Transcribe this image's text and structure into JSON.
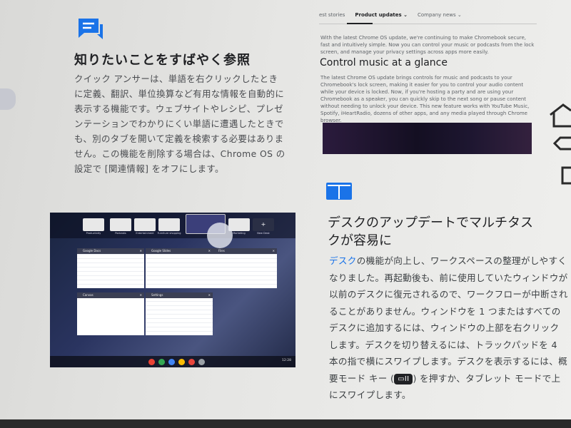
{
  "left": {
    "icon": "chat-bubbles-icon",
    "heading": "知りたいことをすばやく参照",
    "paragraph": "クイック アンサーは、単語を右クリックしたときに定義、翻訳、単位換算など有用な情報を自動的に表示する機能です。ウェブサイトやレシピ、プレゼンテーションでわかりにくい単語に遭遇したときでも、別のタブを開いて定義を検索する必要はありません。この機能を削除する場合は、Chrome OS の設定で [関連情報] をオフにします。"
  },
  "tabs": [
    {
      "label": "est stories"
    },
    {
      "label": "Product updates ⌄"
    },
    {
      "label": "Company news ⌄"
    }
  ],
  "right_top": {
    "intro": "With the latest Chrome OS update, we're continuing to make Chromebook secure, fast and intuitively simple. Now you can control your music or podcasts from the lock screen, and manage your privacy settings across apps more easily.",
    "heading": "Control music at a glance",
    "body": "The latest Chrome OS update brings controls for music and podcasts to your Chromebook's lock screen, making it easier for you to control your audio content while your device is locked. Now, if you're hosting a party and are using your Chromebook as a speaker, you can quickly skip to the next song or pause content without needing to unlock your device. This new feature works with YouTube Music, Spotify, iHeartRadio, dozens of other apps, and any media played through Chrome browser."
  },
  "right_bottom": {
    "icon": "desks-icon",
    "heading": "デスクのアップデートでマルチタスクが容易に",
    "link": "デスク",
    "paragraph_a": "の機能が向上し、ワークスペースの整理がしやすくなりました。再起動後も、前に使用していたウィンドウが以前のデスクに復元されるので、ワークフローが中断されることがありません。ウィンドウを 1 つまたはすべてのデスクに追加するには、ウィンドウの上部を右クリックします。デスクを切り替えるには、トラックパッドを 4 本の指で横にスワイプします。デスクを表示するには、概要モード キー (",
    "key": "▭II",
    "paragraph_b": ") を押すか、タブレット モードで上にスワイプします。"
  },
  "screenshot": {
    "desks": [
      "Productivity",
      "Podcasts",
      "Entertainment",
      "Furniture shopping",
      "",
      "Marketing",
      "New Desk"
    ],
    "windows": [
      "Google Docs",
      "Google Slides",
      "Files",
      "Canvas",
      "Settings"
    ],
    "time": "12:28"
  }
}
